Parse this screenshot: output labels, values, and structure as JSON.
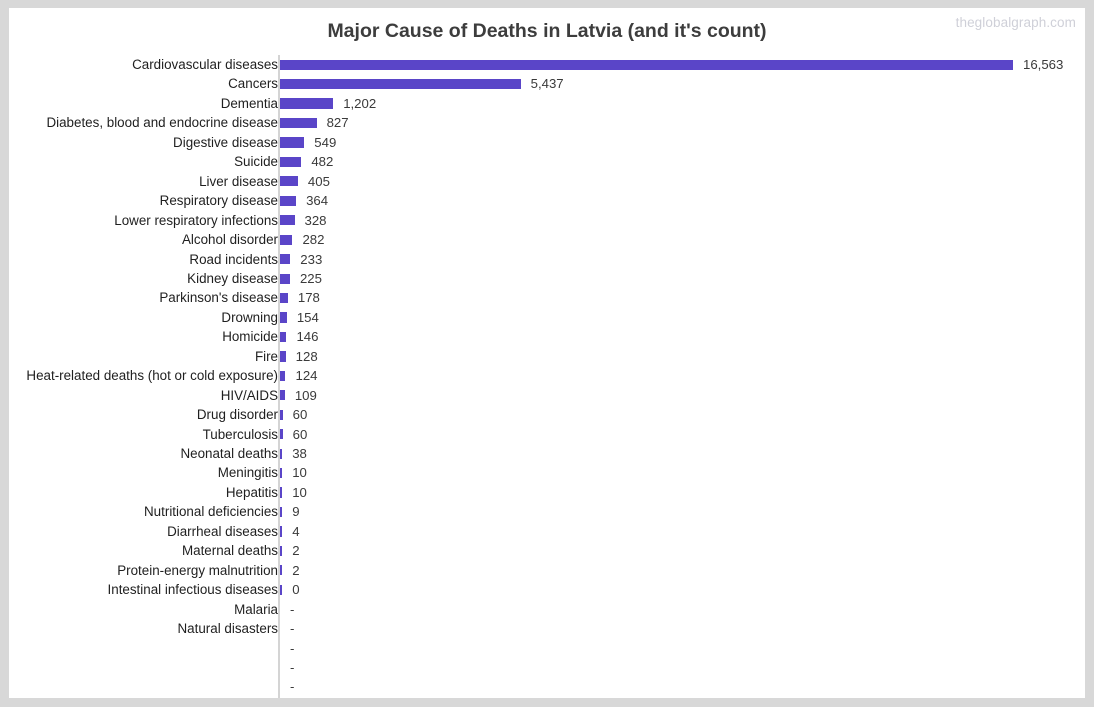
{
  "watermark": "theglobalgraph.com",
  "title": "Major Cause of Deaths in Latvia (and it's count)",
  "colors": {
    "bar": "#5a45c8",
    "title_text": "#3d3d3d",
    "category_text": "#1f1f1f",
    "value_text": "#3a3a3a",
    "axis_line": "#d4d4d4",
    "frame": "#d8d8d8",
    "background": "#ffffff",
    "watermark_text": "#cfd0d8"
  },
  "chart_data": {
    "type": "bar",
    "orientation": "horizontal",
    "title": "Major Cause of Deaths in Latvia (and it's count)",
    "xlabel": "",
    "ylabel": "",
    "grid": false,
    "legend": null,
    "xlim": [
      0,
      16563
    ],
    "categories": [
      "Cardiovascular diseases",
      "Cancers",
      "Dementia",
      "Diabetes, blood and endocrine disease",
      "Digestive disease",
      "Suicide",
      "Liver disease",
      "Respiratory disease",
      "Lower respiratory infections",
      "Alcohol disorder",
      "Road incidents",
      "Kidney disease",
      "Parkinson's disease",
      "Drowning",
      "Homicide",
      "Fire",
      "Heat-related deaths (hot or cold exposure)",
      "HIV/AIDS",
      "Drug disorder",
      "Tuberculosis",
      "Neonatal deaths",
      "Meningitis",
      "Hepatitis",
      "Nutritional deficiencies",
      "Diarrheal diseases",
      "Maternal deaths",
      "Protein-energy malnutrition",
      "Intestinal infectious diseases",
      "Malaria",
      "Natural disasters",
      "",
      "",
      ""
    ],
    "values": [
      16563,
      5437,
      1202,
      827,
      549,
      482,
      405,
      364,
      328,
      282,
      233,
      225,
      178,
      154,
      146,
      128,
      124,
      109,
      60,
      60,
      38,
      10,
      10,
      9,
      4,
      2,
      2,
      0,
      null,
      null,
      null,
      null,
      null
    ],
    "value_labels": [
      "16,563",
      "5,437",
      "1,202",
      "827",
      "549",
      "482",
      "405",
      "364",
      "328",
      "282",
      "233",
      "225",
      "178",
      "154",
      "146",
      "128",
      "124",
      "109",
      "60",
      "60",
      "38",
      "10",
      "10",
      "9",
      "4",
      "2",
      "2",
      "0",
      "-",
      "-",
      "-",
      "-",
      "-"
    ]
  }
}
